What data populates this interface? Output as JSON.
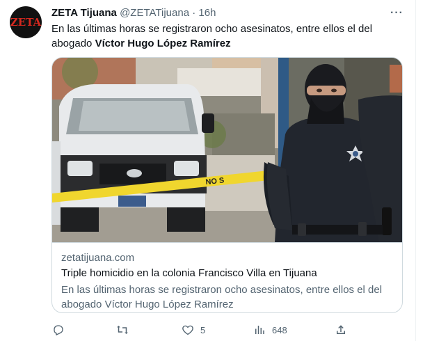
{
  "tweet": {
    "author_name": "ZETA Tijuana",
    "author_handle": "@ZETATijuana",
    "separator": "·",
    "time": "16h",
    "avatar_text": "ZETA",
    "more_label": "···",
    "text_plain": "En las últimas horas se registraron ocho asesinatos, entre ellos el del abogado ",
    "text_bold": "Víctor Hugo López Ramírez"
  },
  "card": {
    "photo_tape_text": "NO S",
    "domain": "zetatijuana.com",
    "title": "Triple homicidio en la colonia Francisco Villa en Tijuana",
    "description": "En las últimas horas se registraron ocho asesinatos, entre ellos el del abogado Víctor Hugo López Ramírez"
  },
  "actions": {
    "reply": {
      "icon": "reply-icon",
      "count": ""
    },
    "retweet": {
      "icon": "retweet-icon",
      "count": ""
    },
    "like": {
      "icon": "heart-icon",
      "count": "5"
    },
    "views": {
      "icon": "views-icon",
      "count": "648"
    },
    "share": {
      "icon": "share-icon",
      "count": ""
    }
  },
  "colors": {
    "text_primary": "#0f1419",
    "text_secondary": "#536471",
    "border": "#cfd9de",
    "brand_red": "#d5281f"
  }
}
